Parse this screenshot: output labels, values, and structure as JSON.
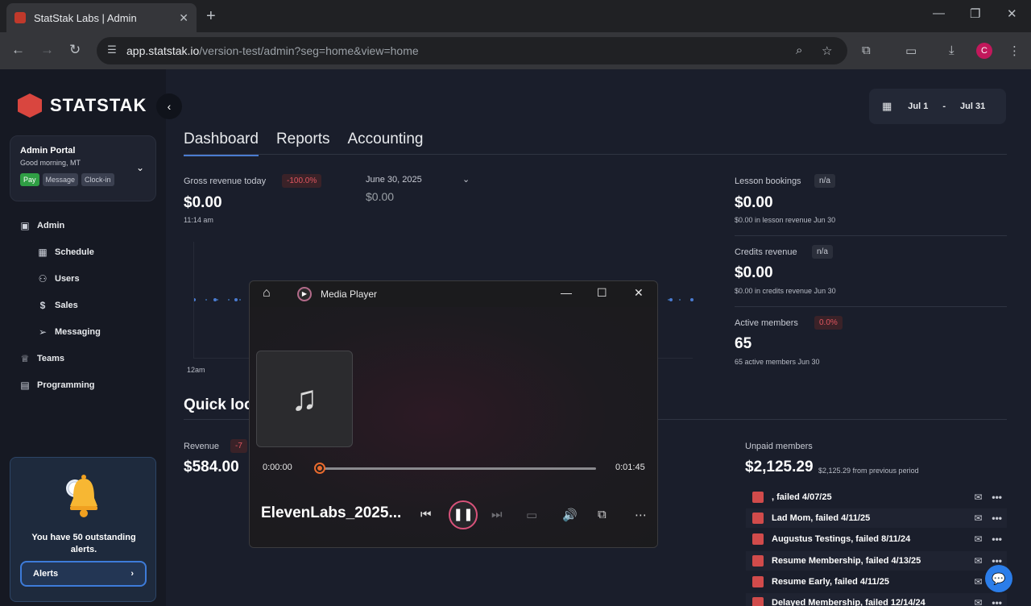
{
  "browser": {
    "tab_title": "StatStak Labs | Admin",
    "tab_close": "✕",
    "new_tab": "+",
    "url_host": "app.statstak.io",
    "url_path": "/version-test/admin?seg=home&view=home",
    "profile_initial": "C"
  },
  "brand": {
    "name": "STATSTAK",
    "accent": "#d9463f"
  },
  "portal": {
    "title": "Admin Portal",
    "greeting": "Good morning, MT",
    "buttons": [
      "Pay",
      "Message",
      "Clock-in"
    ]
  },
  "sidebar": {
    "items": [
      {
        "label": "Admin"
      },
      {
        "label": "Schedule"
      },
      {
        "label": "Users"
      },
      {
        "label": "Sales"
      },
      {
        "label": "Messaging"
      },
      {
        "label": "Teams"
      },
      {
        "label": "Programming"
      }
    ]
  },
  "alerts": {
    "message": "You have 50 outstanding alerts.",
    "button": "Alerts"
  },
  "date_range": {
    "start": "Jul 1",
    "separator": "-",
    "end": "Jul 31"
  },
  "tabs": [
    "Dashboard",
    "Reports",
    "Accounting"
  ],
  "gross": {
    "label": "Gross revenue today",
    "badge": "-100.0%",
    "value": "$0.00",
    "time": "11:14 am",
    "compare_date": "June 30, 2025",
    "compare_value": "$0.00",
    "chart_axis_label": "12am"
  },
  "kpis": {
    "lesson": {
      "label": "Lesson bookings",
      "badge": "n/a",
      "value": "$0.00",
      "sub": "$0.00 in lesson revenue Jun 30"
    },
    "credits": {
      "label": "Credits revenue",
      "badge": "n/a",
      "value": "$0.00",
      "sub": "$0.00 in credits revenue Jun 30"
    },
    "active": {
      "label": "Active members",
      "badge": "0.0%",
      "value": "65",
      "sub": "65 active members Jun 30"
    }
  },
  "quick": {
    "heading": "Quick loo",
    "revenue_label": "Revenue",
    "revenue_badge": "-7",
    "revenue_value": "$584.00"
  },
  "unpaid": {
    "label": "Unpaid members",
    "value": "$2,125.29",
    "sub": "$2,125.29 from previous period",
    "rows": [
      ", failed 4/07/25",
      "Lad Mom, failed 4/11/25",
      "Augustus Testings, failed 8/11/24",
      "Resume Membership, failed 4/13/25",
      "Resume Early, failed 4/11/25",
      "Delayed Membership, failed 12/14/24"
    ]
  },
  "media_player": {
    "app_title": "Media Player",
    "elapsed": "0:00:00",
    "duration": "0:01:45",
    "progress": 0.0,
    "track_title": "ElevenLabs_2025...",
    "accent": "#e86a2e"
  }
}
